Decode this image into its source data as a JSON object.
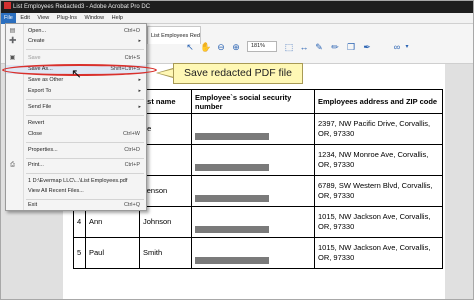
{
  "window": {
    "title": "List Employees Redacted3 - Adobe Acrobat Pro DC"
  },
  "menubar": [
    "File",
    "Edit",
    "View",
    "Plug-Ins",
    "Window",
    "Help"
  ],
  "toolbar": {
    "doc_tab": "List Employees Red...",
    "zoom": "181%"
  },
  "file_menu": {
    "items": [
      {
        "icon": "open-icon",
        "label": "Open...",
        "shortcut": "Ctrl+O"
      },
      {
        "icon": "create-icon",
        "label": "Create",
        "shortcut": ""
      },
      {
        "icon": "save-icon",
        "label": "Save",
        "shortcut": "Ctrl+S"
      },
      {
        "icon": "",
        "label": "Save As...",
        "shortcut": "Shift+Ctrl+S"
      },
      {
        "icon": "",
        "label": "Save as Other",
        "shortcut": ""
      },
      {
        "icon": "",
        "label": "Export To",
        "shortcut": ""
      },
      {
        "icon": "",
        "label": "Send File",
        "shortcut": ""
      },
      {
        "icon": "",
        "label": "Revert",
        "shortcut": ""
      },
      {
        "icon": "",
        "label": "Close",
        "shortcut": "Ctrl+W"
      },
      {
        "icon": "",
        "label": "Properties...",
        "shortcut": "Ctrl+D"
      },
      {
        "icon": "print-icon",
        "label": "Print...",
        "shortcut": "Ctrl+P"
      },
      {
        "icon": "",
        "label": "1 D:\\Evermap LLC\\...\\List Employees.pdf",
        "shortcut": ""
      },
      {
        "icon": "",
        "label": "View All Recent Files...",
        "shortcut": ""
      },
      {
        "icon": "",
        "label": "Exit",
        "shortcut": "Ctrl+Q"
      }
    ]
  },
  "callout": {
    "text": "Save redacted PDF file"
  },
  "table": {
    "headers": [
      "",
      "",
      "ast name",
      "Employee`s social security number",
      "Employees address and ZIP code"
    ],
    "rows": [
      {
        "num": "",
        "first": "",
        "last": "oe",
        "address": "2397, NW Pacific Drive, Corvallis, OR, 97330"
      },
      {
        "num": "",
        "first": "",
        "last": "",
        "address": "1234, NW Monroe Ave, Corvallis, OR, 97330"
      },
      {
        "num": "",
        "first": "",
        "last": "venson",
        "address": "6789, SW Western Blvd, Corvallis, OR, 97330"
      },
      {
        "num": "4",
        "first": "Ann",
        "last": "Johnson",
        "address": "1015, NW Jackson Ave, Corvallis, OR, 97330"
      },
      {
        "num": "5",
        "first": "Paul",
        "last": "Smith",
        "address": "1015, NW Jackson Ave, Corvallis, OR, 97330"
      }
    ]
  }
}
